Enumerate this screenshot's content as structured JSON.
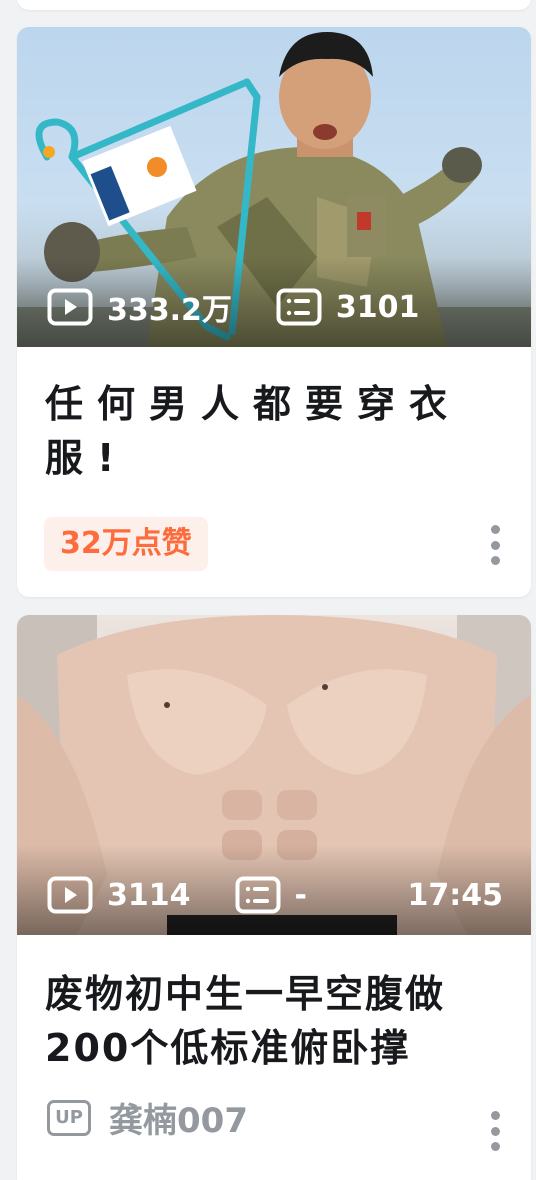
{
  "feed": {
    "cards": [
      {
        "views": "333.2万",
        "danmaku": "3101",
        "duration": "",
        "title": "任何男人都要穿衣服!",
        "badge": "32万点赞",
        "uploader": ""
      },
      {
        "views": "3114",
        "danmaku": "-",
        "duration": "17:45",
        "title": "废物初中生一早空腹做200个低标准俯卧撑",
        "badge": "",
        "up_label": "UP",
        "uploader": "龚楠007"
      }
    ]
  },
  "colors": {
    "background": "#f1f2f3",
    "card": "#ffffff",
    "title_text": "#18191c",
    "secondary_text": "#9499a0",
    "like_badge_text": "#fe6c3d",
    "like_badge_bg": "#fdefe9"
  },
  "icons": [
    "play-count-icon",
    "danmaku-icon",
    "more-options-icon",
    "up-badge-icon"
  ]
}
